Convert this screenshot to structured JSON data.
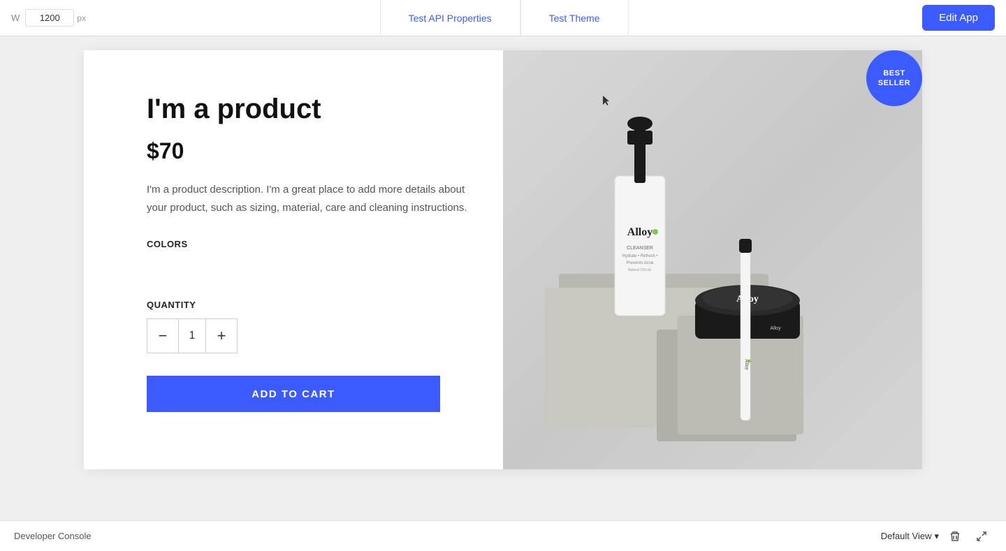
{
  "toolbar": {
    "width_label": "W",
    "width_value": "1200",
    "width_unit": "px",
    "tab_api": "Test API Properties",
    "tab_theme": "Test Theme",
    "edit_app_label": "Edit App"
  },
  "product": {
    "title": "I'm a product",
    "price": "$70",
    "description": "I'm a product description. I'm a great place to add more details about your product, such as sizing, material, care and cleaning instructions.",
    "colors_label": "COLORS",
    "quantity_label": "QUANTITY",
    "quantity_value": "1",
    "qty_minus": "−",
    "qty_plus": "+",
    "add_to_cart": "ADD TO CART",
    "badge_line1": "BEST",
    "badge_line2": "SELLER"
  },
  "bottom_bar": {
    "dev_console": "Developer Console",
    "view_label": "Default View"
  }
}
